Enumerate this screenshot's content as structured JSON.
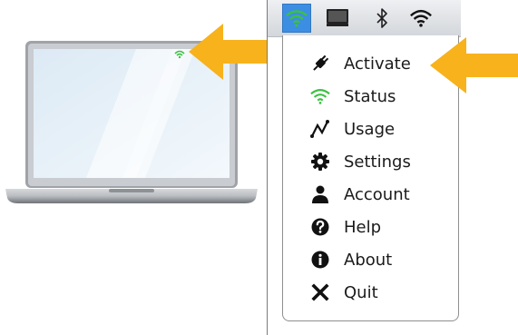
{
  "menubar": {
    "tray_icons": [
      {
        "name": "wifi-status-icon",
        "active": true
      },
      {
        "name": "monitor-icon",
        "active": false
      },
      {
        "name": "bluetooth-icon",
        "active": false
      },
      {
        "name": "wifi-icon",
        "active": false
      }
    ]
  },
  "menu": {
    "items": [
      {
        "label": "Activate",
        "icon": "plug-icon"
      },
      {
        "label": "Status",
        "icon": "wifi-signal-icon"
      },
      {
        "label": "Usage",
        "icon": "chart-line-icon"
      },
      {
        "label": "Settings",
        "icon": "gear-icon"
      },
      {
        "label": "Account",
        "icon": "user-icon"
      },
      {
        "label": "Help",
        "icon": "question-circle-icon"
      },
      {
        "label": "About",
        "icon": "info-circle-icon"
      },
      {
        "label": "Quit",
        "icon": "close-icon"
      }
    ]
  },
  "colors": {
    "accent_blue": "#3c8ee3",
    "wifi_green": "#3cc142",
    "arrow_orange": "#f7b21c"
  }
}
